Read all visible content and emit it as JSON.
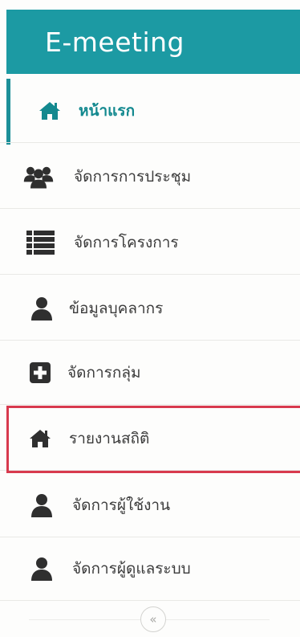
{
  "brand": {
    "title": "E-meeting"
  },
  "nav": {
    "items": [
      {
        "label": "หน้าแรก",
        "icon": "home-icon",
        "active": true
      },
      {
        "label": "จัดการการประชุม",
        "icon": "users-icon"
      },
      {
        "label": "จัดการโครงการ",
        "icon": "list-icon"
      },
      {
        "label": "ข้อมูลบุคลากร",
        "icon": "user-icon"
      },
      {
        "label": "จัดการกลุ่ม",
        "icon": "plus-square-icon"
      },
      {
        "label": "รายงานสถิติ",
        "icon": "home-icon",
        "highlighted": true
      },
      {
        "label": "จัดการผู้ใช้งาน",
        "icon": "user-icon"
      },
      {
        "label": "จัดการผู้ดูแลระบบ",
        "icon": "user-icon"
      }
    ]
  },
  "collapse": {
    "glyph": "«"
  },
  "colors": {
    "brand": "#1c9aa3",
    "active_text": "#13898f",
    "highlight_border": "#d83a4e",
    "icon": "#2f2f2f"
  }
}
